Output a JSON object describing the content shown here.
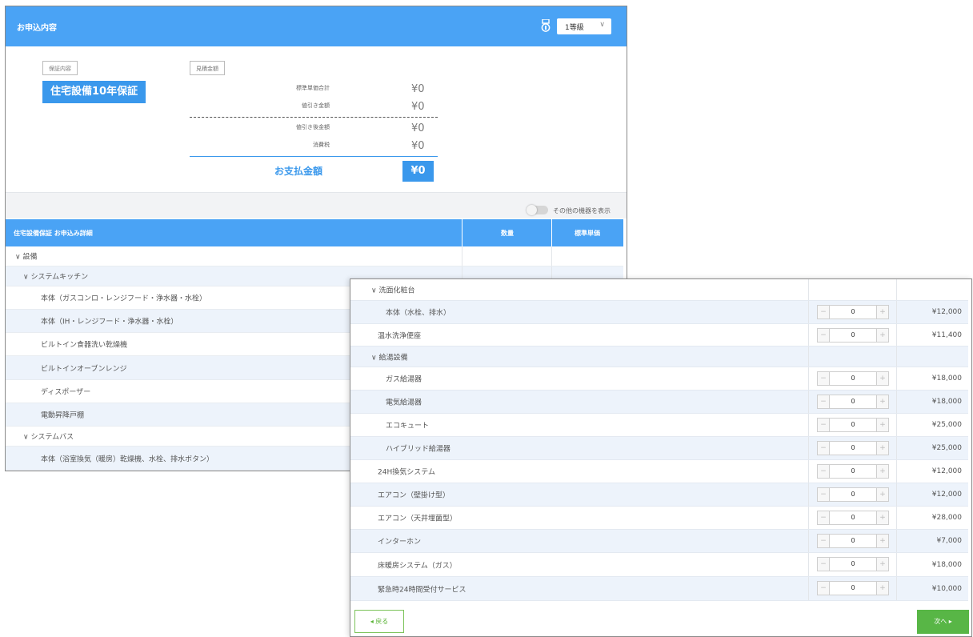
{
  "summary_window": {
    "title": "お申込内容",
    "tier_select": "1等級",
    "coverage_tag": "保証内容",
    "plan_name": "住宅設備10年保証",
    "cost_tag": "見積金額",
    "cost_rows": [
      {
        "label": "標準単価合計",
        "value": "¥0"
      },
      {
        "label": "値引き金額",
        "value": "¥0"
      },
      {
        "label": "値引き後金額",
        "value": "¥0"
      },
      {
        "label": "消費税",
        "value": "¥0"
      }
    ],
    "total_label": "お支払金額",
    "total_value": "¥0",
    "toggle_label": "その他の機器を表示"
  },
  "detail_table": {
    "header_title": "住宅設備保証 お申込み詳細",
    "col_quantity": "数量",
    "col_unit_price": "標準単価",
    "rows": [
      {
        "label": "∨ 設備"
      },
      {
        "label": "∨ システムキッチン"
      },
      {
        "label": "本体（ガスコンロ・レンジフード・浄水器・水栓）"
      },
      {
        "label": "本体（IH・レンジフード・浄水器・水栓）"
      },
      {
        "label": "ビルトイン食器洗い乾燥機"
      },
      {
        "label": "ビルトインオーブンレンジ"
      },
      {
        "label": "ディスポーザー"
      },
      {
        "label": "電動昇降戸棚"
      },
      {
        "label": "∨ システムバス"
      },
      {
        "label": "本体（浴室換気（暖房）乾燥機、水栓、排水ボタン）"
      }
    ]
  },
  "price_window": {
    "rows": [
      {
        "label": "∨ 洗面化粧台",
        "qty": "",
        "price": ""
      },
      {
        "label": "本体（水栓、排水）",
        "qty": "0",
        "price": "¥12,000"
      },
      {
        "label": "温水洗浄便座",
        "qty": "0",
        "price": "¥11,400"
      },
      {
        "label": "∨ 給湯設備",
        "qty": "",
        "price": ""
      },
      {
        "label": "ガス給湯器",
        "qty": "0",
        "price": "¥18,000"
      },
      {
        "label": "電気給湯器",
        "qty": "0",
        "price": "¥18,000"
      },
      {
        "label": "エコキュート",
        "qty": "0",
        "price": "¥25,000"
      },
      {
        "label": "ハイブリッド給湯器",
        "qty": "0",
        "price": "¥25,000"
      },
      {
        "label": "24H換気システム",
        "qty": "0",
        "price": "¥12,000"
      },
      {
        "label": "エアコン（壁掛け型）",
        "qty": "0",
        "price": "¥12,000"
      },
      {
        "label": "エアコン（天井埋菌型）",
        "qty": "0",
        "price": "¥28,000"
      },
      {
        "label": "インターホン",
        "qty": "0",
        "price": "¥7,000"
      },
      {
        "label": "床暖房システム（ガス）",
        "qty": "0",
        "price": "¥18,000"
      },
      {
        "label": "緊急時24時間受付サービス",
        "qty": "0",
        "price": "¥10,000"
      }
    ],
    "minus_symbol": "−",
    "plus_symbol": "+",
    "back_button": "◂ 戻る",
    "next_button": "次へ ▸"
  }
}
